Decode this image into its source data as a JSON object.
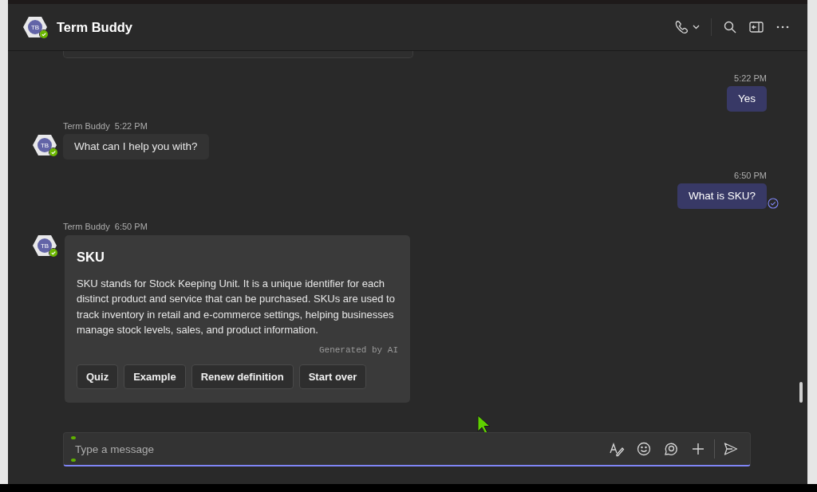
{
  "header": {
    "title": "Term Buddy",
    "avatar_initials": "TB",
    "online": true
  },
  "messages": [
    {
      "kind": "sent",
      "time": "5:22 PM",
      "text": "Yes",
      "seen": false
    },
    {
      "kind": "received",
      "sender": "Term Buddy",
      "avatar_initials": "TB",
      "online": true,
      "time": "5:22 PM",
      "text": "What can I help you with?"
    },
    {
      "kind": "sent",
      "time": "6:50 PM",
      "text": "What is SKU?",
      "seen": true
    },
    {
      "kind": "card",
      "sender": "Term Buddy",
      "avatar_initials": "TB",
      "online": true,
      "time": "6:50 PM",
      "title": "SKU",
      "body": "SKU stands for Stock Keeping Unit. It is a unique identifier for each distinct product and service that can be purchased. SKUs are used to track inventory in retail and e-commerce settings, helping businesses manage stock levels, sales, and product information.",
      "footnote": "Generated by AI",
      "actions": [
        "Quiz",
        "Example",
        "Renew definition",
        "Start over"
      ]
    }
  ],
  "composer": {
    "placeholder": "Type a message"
  }
}
